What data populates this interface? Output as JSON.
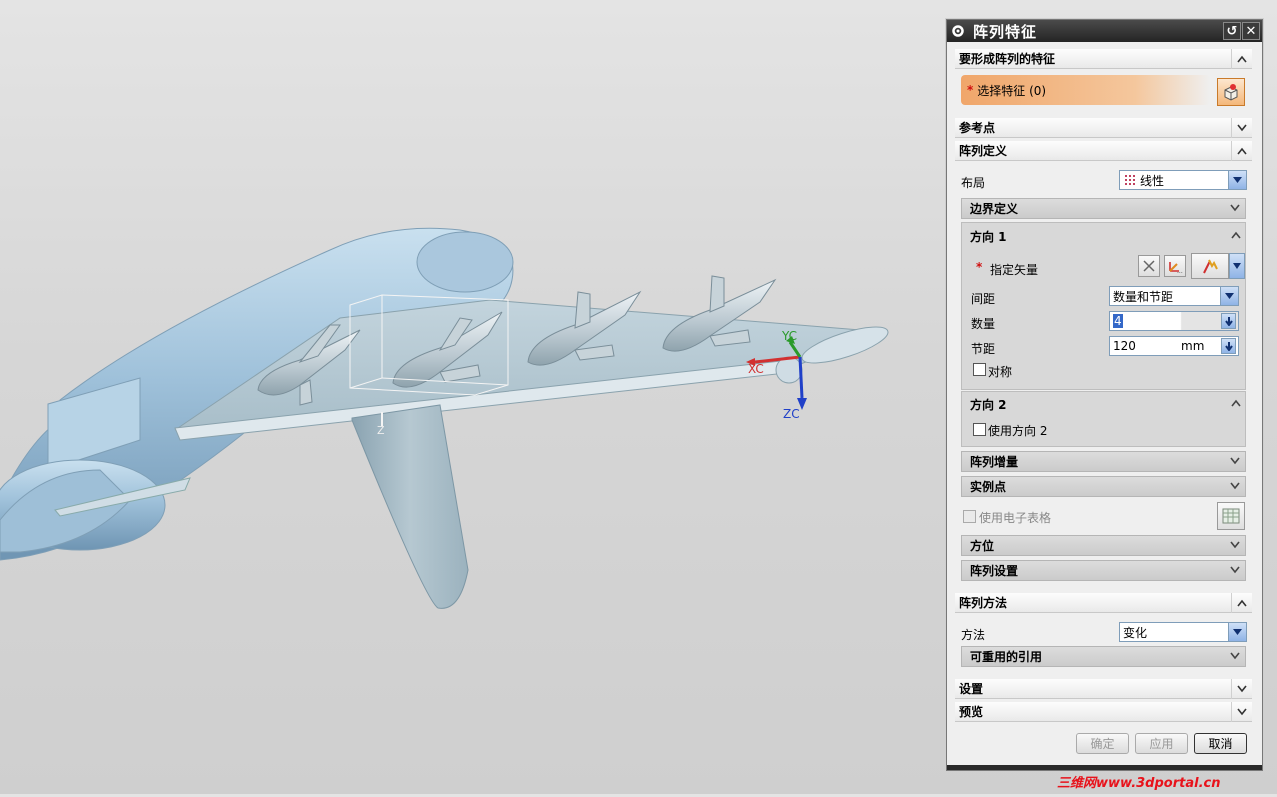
{
  "viewport": {
    "axis_labels": {
      "yc": "YC",
      "xc": "XC",
      "zc": "ZC",
      "z": "Z"
    }
  },
  "dialog": {
    "title": "阵列特征",
    "features_section": {
      "label": "要形成阵列的特征",
      "select_label": "选择特征 (0)",
      "required_mark": "*"
    },
    "reference_point": {
      "label": "参考点"
    },
    "pattern_definition": {
      "label": "阵列定义",
      "layout_label": "布局",
      "layout_value": "线性",
      "boundary": {
        "label": "边界定义"
      },
      "direction1": {
        "label": "方向 1",
        "specify_vector_label": "指定矢量",
        "required_mark": "*",
        "spacing_label": "间距",
        "spacing_value": "数量和节距",
        "count_label": "数量",
        "count_value": "4",
        "pitch_label": "节距",
        "pitch_value": "120",
        "pitch_unit": "mm",
        "symmetric_label": "对称"
      },
      "direction2": {
        "label": "方向 2",
        "use_label": "使用方向 2"
      },
      "increment": {
        "label": "阵列增量"
      },
      "instance_points": {
        "label": "实例点"
      },
      "spreadsheet_label": "使用电子表格",
      "orientation": {
        "label": "方位"
      },
      "pattern_settings": {
        "label": "阵列设置"
      }
    },
    "pattern_method": {
      "label": "阵列方法",
      "method_label": "方法",
      "method_value": "变化",
      "reusable_refs": {
        "label": "可重用的引用"
      }
    },
    "settings": {
      "label": "设置"
    },
    "preview": {
      "label": "预览"
    },
    "buttons": {
      "ok": "确定",
      "apply": "应用",
      "cancel": "取消"
    }
  },
  "watermark": "三维网www.3dportal.cn",
  "colors": {
    "model": "#a9c6dc",
    "accent_orange": "#f0a66a",
    "x_axis": "#d23030",
    "y_axis": "#2a9a2a",
    "z_axis": "#2040c8"
  }
}
